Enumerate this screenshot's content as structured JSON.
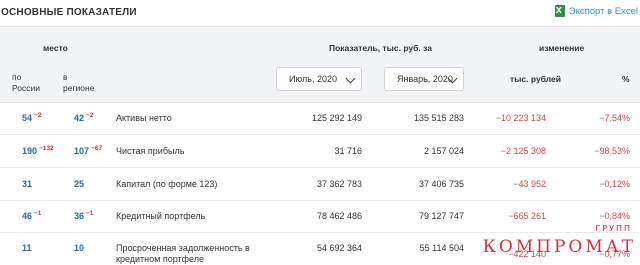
{
  "header": {
    "title": "ОСНОВНЫЕ ПОКАЗАТЕЛИ",
    "export_label": "Экспорт в Excel"
  },
  "table_head": {
    "place": "место",
    "by_russia": "по\nРоссии",
    "in_region": "в\nрегионе",
    "indicator": "Показатель, тыс. руб. за",
    "change": "изменение",
    "thousand_rub": "тыс. рублей",
    "percent": "%",
    "period1": "Июль, 2020",
    "period2": "Январь, 2020"
  },
  "rows": [
    {
      "rank_ru": "54",
      "rank_ru_delta": "−2",
      "rank_reg": "42",
      "rank_reg_delta": "−2",
      "name": "Активы нетто",
      "v1": "125 292 149",
      "v2": "135 515 283",
      "diff": "−10 223 134",
      "pct": "−7,54%"
    },
    {
      "rank_ru": "190",
      "rank_ru_delta": "−132",
      "rank_reg": "107",
      "rank_reg_delta": "−67",
      "name": "Чистая прибыль",
      "v1": "31 716",
      "v2": "2 157 024",
      "diff": "−2 125 308",
      "pct": "−98,53%"
    },
    {
      "rank_ru": "31",
      "rank_ru_delta": "",
      "rank_reg": "25",
      "rank_reg_delta": "",
      "name": "Капитал (по форме 123)",
      "v1": "37 362 783",
      "v2": "37 406 735",
      "diff": "−43 952",
      "pct": "−0,12%"
    },
    {
      "rank_ru": "46",
      "rank_ru_delta": "−1",
      "rank_reg": "36",
      "rank_reg_delta": "−1",
      "name": "Кредитный портфель",
      "v1": "78 462 486",
      "v2": "79 127 747",
      "diff": "−665 261",
      "pct": "−0,84%"
    },
    {
      "rank_ru": "11",
      "rank_ru_delta": "",
      "rank_reg": "10",
      "rank_reg_delta": "",
      "name": "Просроченная задолженность в кредитном портфеле",
      "v1": "54 692 364",
      "v2": "55 114 504",
      "diff": "−422 140",
      "pct": "−0,77%"
    }
  ],
  "watermark": {
    "main": "КОМПРОМАТ",
    "sub": "ГРУПП"
  }
}
